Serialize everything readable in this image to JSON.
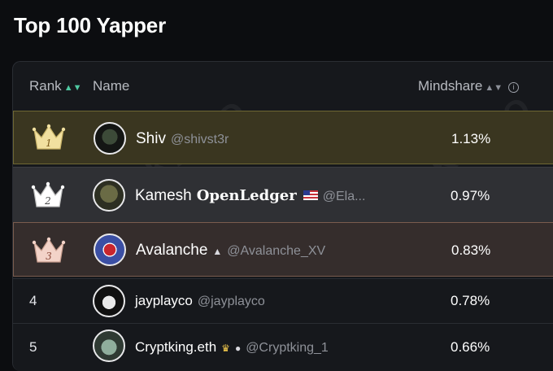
{
  "page": {
    "title": "Top 100 Yapper"
  },
  "watermark": "KAITO",
  "table": {
    "headers": {
      "rank": "Rank",
      "name": "Name",
      "mindshare": "Mindshare"
    },
    "rows": [
      {
        "rank": "1",
        "name": "Shiv",
        "brand": "",
        "handle": "@shivst3r",
        "mindshare": "1.13%"
      },
      {
        "rank": "2",
        "name": "Kamesh",
        "brand": "OpenLedger",
        "handle": "@Ela...",
        "mindshare": "0.97%"
      },
      {
        "rank": "3",
        "name": "Avalanche",
        "brand": "",
        "handle": "@Avalanche_XV",
        "mindshare": "0.83%"
      },
      {
        "rank": "4",
        "name": "jayplayco",
        "brand": "",
        "handle": "@jayplayco",
        "mindshare": "0.78%"
      },
      {
        "rank": "5",
        "name": "Cryptking.eth",
        "brand": "",
        "handle": "@Cryptking_1",
        "mindshare": "0.66%"
      }
    ]
  },
  "icons": {
    "sort_rank": "sort-arrows-icon",
    "sort_mindshare": "sort-arrows-icon",
    "info": "info-icon",
    "crown_gold": "#f1e0a0",
    "crown_silver": "#ffffff",
    "crown_bronze": "#f3d3c8"
  }
}
